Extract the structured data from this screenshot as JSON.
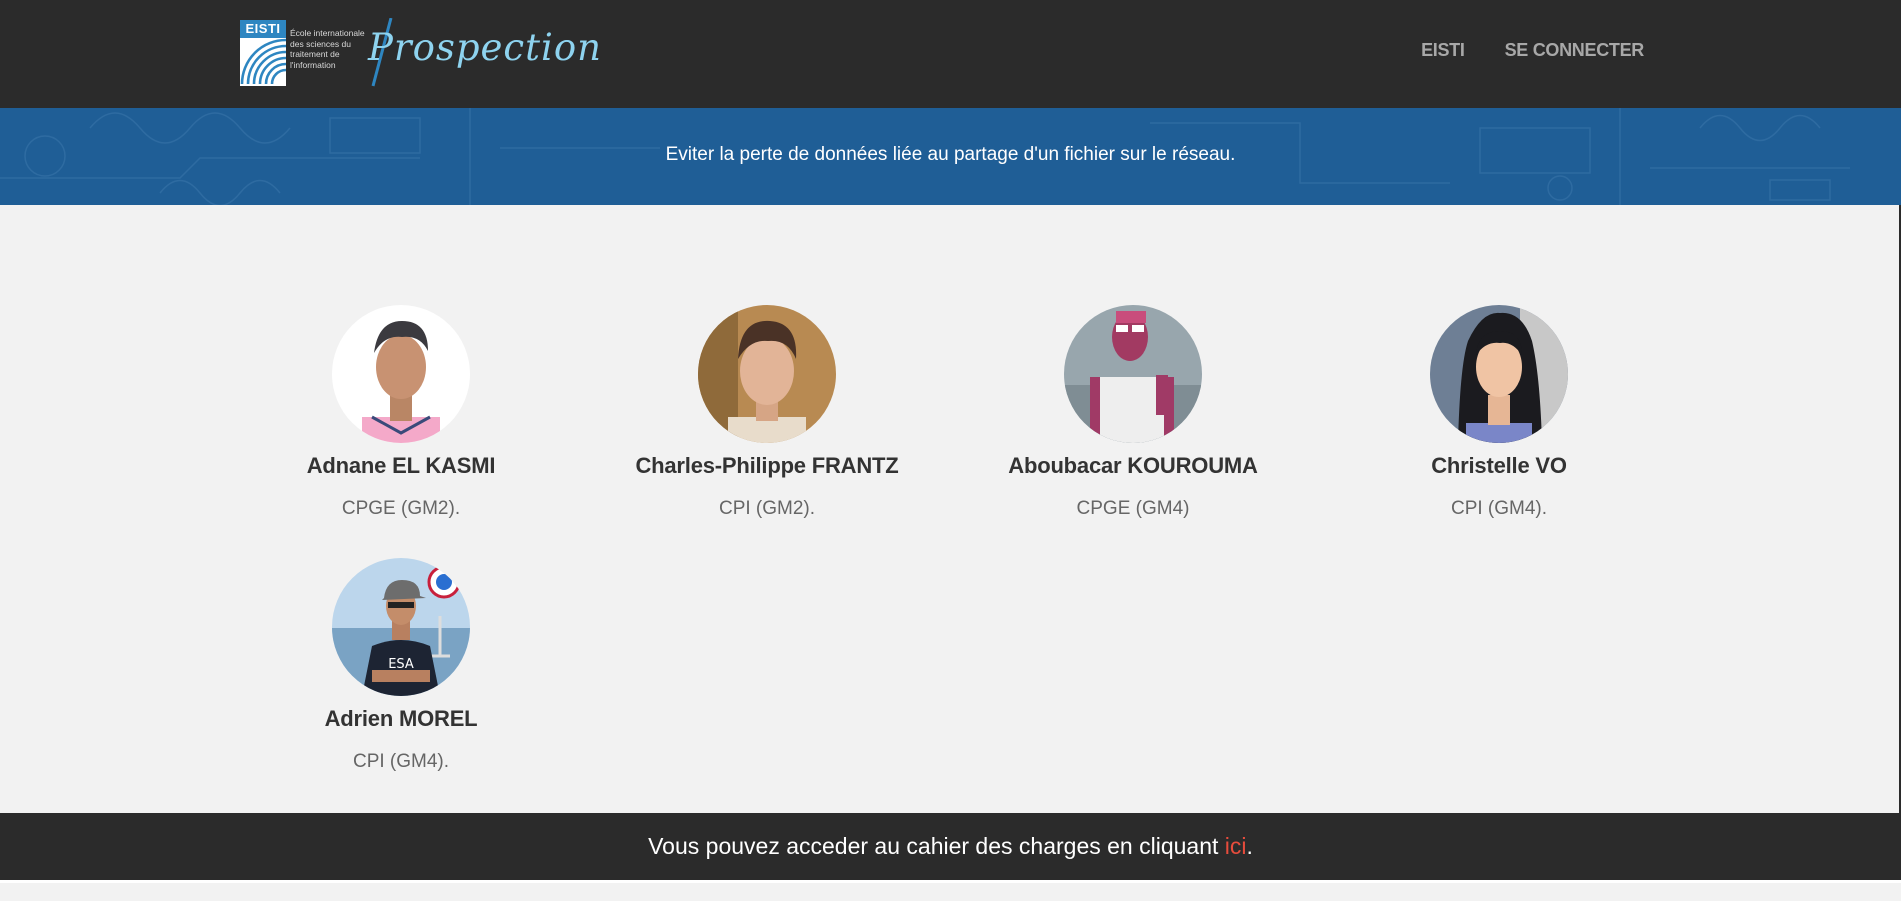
{
  "header": {
    "logo_abbrev": "EISTI",
    "logo_description_lines": [
      "École internationale",
      "des sciences du",
      "traitement de",
      "l'information"
    ],
    "logo_script": "Prospection",
    "nav": [
      {
        "label": "EISTI"
      },
      {
        "label": "SE CONNECTER"
      }
    ]
  },
  "banner": {
    "tagline": "Eviter la perte de données liée au partage d'un fichier sur le réseau."
  },
  "team": [
    {
      "name": "Adnane EL KASMI",
      "program": "CPGE (GM2)."
    },
    {
      "name": "Charles-Philippe FRANTZ",
      "program": "CPI (GM2)."
    },
    {
      "name": "Aboubacar KOUROUMA",
      "program": "CPGE (GM4)"
    },
    {
      "name": "Christelle VO",
      "program": "CPI (GM4)."
    },
    {
      "name": "Adrien MOREL",
      "program": "CPI (GM4)."
    }
  ],
  "footer": {
    "text_before": "Vous pouvez acceder au cahier des charges en cliquant ",
    "link_label": "ici",
    "text_after": "."
  },
  "colors": {
    "navbar_bg": "#2b2b2b",
    "banner_bg": "#1f5e96",
    "page_bg": "#f2f2f2",
    "link_accent": "#e74c3c",
    "logo_script": "#8ed3ef"
  }
}
